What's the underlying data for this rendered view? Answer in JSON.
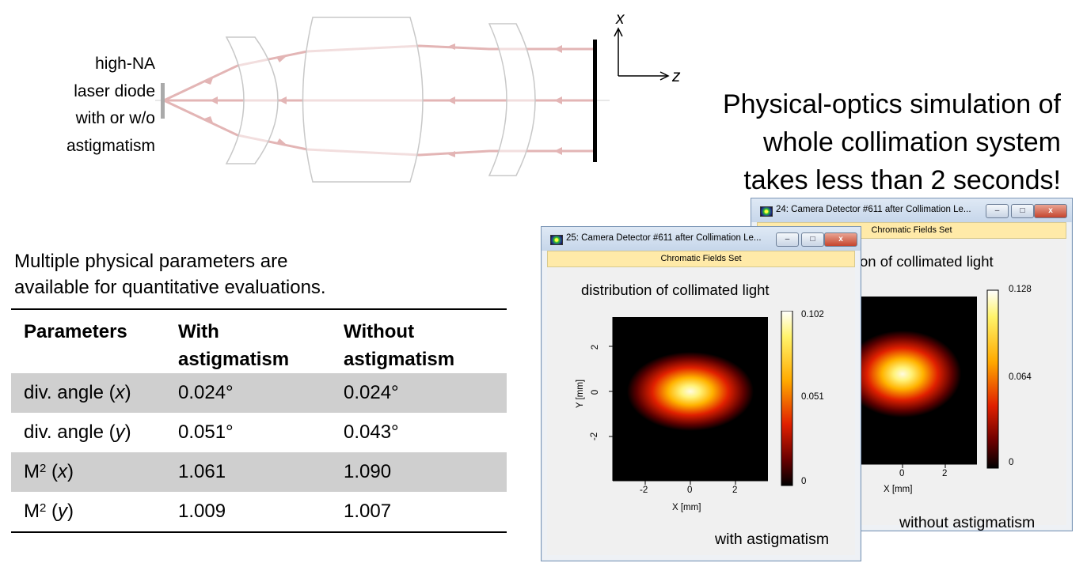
{
  "diagram": {
    "source_label": [
      "high-NA",
      "laser diode",
      "with or w/o",
      "astigmatism"
    ],
    "axis_x": "x",
    "axis_z": "z"
  },
  "headline": [
    "Physical-optics simulation of",
    "whole collimation system",
    "takes less than 2 seconds!"
  ],
  "intro": [
    "Multiple physical parameters are",
    "available for quantitative evaluations."
  ],
  "table": {
    "headers": [
      "Parameters",
      "With\nastigmatism",
      "Without\nastigmatism"
    ],
    "rows": [
      {
        "param": "div. angle (",
        "var": "x",
        "suffix": ")",
        "sup": "",
        "with": "0.024°",
        "without": "0.024°",
        "shaded": true
      },
      {
        "param": "div. angle (",
        "var": "y",
        "suffix": ")",
        "sup": "",
        "with": "0.051°",
        "without": "0.043°",
        "shaded": false
      },
      {
        "param": "M",
        "var": "x",
        "suffix": ")",
        "sup": "2",
        "with": "1.061",
        "without": "1.090",
        "shaded": true
      },
      {
        "param": "M",
        "var": "y",
        "suffix": ")",
        "sup": "2",
        "with": "1.009",
        "without": "1.007",
        "shaded": false
      }
    ]
  },
  "windows": {
    "back": {
      "title": "24: Camera Detector #611 after Collimation Le...",
      "toolbar": "Chromatic Fields Set",
      "plot_title": "on  of collimated  light",
      "caption": "without  astigmatism",
      "colorbar_ticks": [
        "0.128",
        "0.064",
        "0"
      ],
      "x_ticks": [
        "0",
        "2"
      ],
      "xlabel": "X [mm]",
      "beam_ellipticity": 1.35
    },
    "front": {
      "title": "25: Camera Detector #611 after Collimation Le...",
      "toolbar": "Chromatic Fields Set",
      "plot_title": "distribution  of collimated  light",
      "caption": "with  astigmatism",
      "colorbar_ticks": [
        "0.102",
        "0.051",
        "0"
      ],
      "x_ticks": [
        "-2",
        "0",
        "2"
      ],
      "y_ticks": [
        "2",
        "0",
        "-2"
      ],
      "xlabel": "X [mm]",
      "ylabel": "Y [mm]",
      "beam_ellipticity": 1.6
    },
    "buttons": {
      "minimize": "–",
      "maximize": "□",
      "close": "x"
    }
  },
  "colors": {
    "ray": "#e3b5b5",
    "lens_stroke": "#c8c8c8",
    "table_shade": "#cfcfcf",
    "toolbar_bg": "#ffeaa8"
  }
}
